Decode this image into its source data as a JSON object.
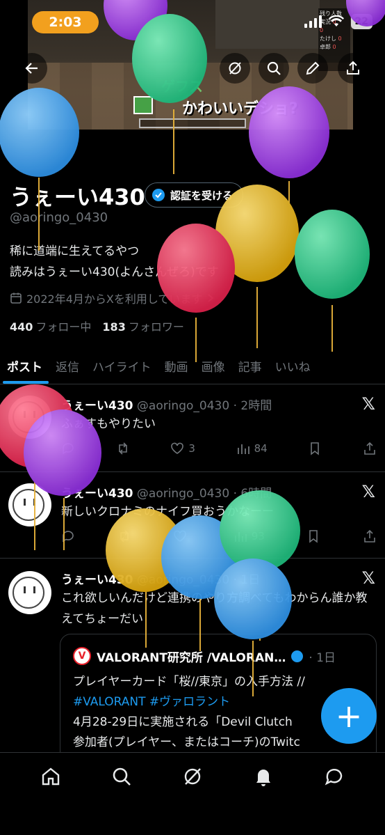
{
  "status_bar": {
    "time": "2:03",
    "battery": "22"
  },
  "banner": {
    "scoreboard": [
      "残り人数",
      "実況",
      "",
      "たけし",
      "卓郎"
    ],
    "scoreboard_values": [
      "",
      "0",
      "0",
      "0",
      "0"
    ],
    "title_line1": "ゲフス",
    "title_line2": "かわいいデショ?"
  },
  "profile": {
    "name": "うぇーい430",
    "verify_button": "認証を受ける",
    "handle": "@aoringo_0430",
    "bio_line1": "稀に道端に生えてるやつ",
    "bio_line2": "読みはうぇーい430(よんさんぜろ)です",
    "joined": "2022年4月からXを利用しています",
    "following_count": "440",
    "following_label": "フォロー中",
    "followers_count": "183",
    "followers_label": "フォロワー"
  },
  "tabs": [
    "ポスト",
    "返信",
    "ハイライト",
    "動画",
    "画像",
    "記事",
    "いいね"
  ],
  "posts": [
    {
      "name": "うぇーい430",
      "meta": "@aoringo_0430 · 2時間",
      "text": "ふぁすもやりたい",
      "likes": "3",
      "views": "84"
    },
    {
      "name": "うぇーい430",
      "meta": "@aoringo_0430 · 6時間",
      "text": "新しいクロナミのナイフ買おうかなーー",
      "likes": "",
      "views": "93"
    },
    {
      "name": "うぇーい430",
      "meta": "@aoringo_0430 · 1日",
      "text": "これ欲しいんだけど連携のやり方調べてもわからん誰か教えてちょーだい",
      "quote": {
        "logo": "V",
        "name": "VALORANT研究所 /VALORAN…",
        "time": "· 1日",
        "line1": "プレイヤーカード「桜//東京」の入手方法 //",
        "line2": "#VALORANT #ヴァロラント",
        "line3": "4月28-29日に実施される「Devil Clutch",
        "line4": "参加者(プレイヤー、またはコーチ)のTwitc"
      }
    }
  ],
  "x_logo": "𝕏",
  "fab": "+",
  "colors": {
    "accent": "#1d9bf0",
    "time_pill": "#f2a01e"
  }
}
